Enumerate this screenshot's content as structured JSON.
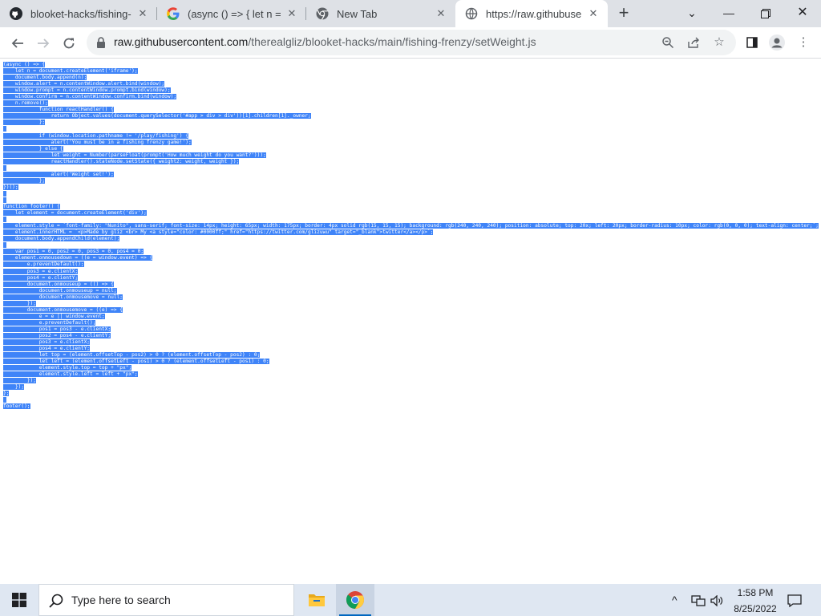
{
  "browser": {
    "tabs": [
      {
        "title": "blooket-hacks/fishing-frenzy",
        "icon": "github-icon"
      },
      {
        "title": "(async () => { let n = doc",
        "icon": "google-icon"
      },
      {
        "title": "New Tab",
        "icon": "chrome-icon"
      },
      {
        "title": "https://raw.githubusercontent.com",
        "icon": "globe-icon"
      }
    ],
    "new_tab_label": "+",
    "url_host": "raw.githubusercontent.com",
    "url_path": "/therealgliz/blooket-hacks/main/fishing-frenzy/setWeight.js"
  },
  "code": {
    "lines": [
      "(async () => {",
      "    let n = document.createElement('iframe');",
      "    document.body.append(n);",
      "    window.alert = n.contentWindow.alert.bind(window);",
      "    window.prompt = n.contentWindow.prompt.bind(window);",
      "    window.confirm = n.contentWindow.confirm.bind(window);",
      "    n.remove();",
      "            function reactHandler() {",
      "                return Object.values(document.querySelector('#app > div > div'))[1].children[1]._owner;",
      "            };",
      "",
      "            if (window.location.pathname != '/play/fishing') {",
      "                alert('You must be in a fishing frenzy game!');",
      "            } else {",
      "                let weight = Number(parseFloat(prompt('How much weight do you want?')));",
      "                reactHandler().stateNode.setState({ weight2: weight, weight });",
      "",
      "                alert('Weight set!');",
      "            };",
      "})();",
      "",
      "",
      "function footer() {",
      "    let element = document.createElement('div');",
      "",
      "    element.style = `font-family: \"Nunito\", sans-serif; font-size: 14px; height: 65px; width: 175px; border: 4px solid rgb(15, 15, 15); background: rgb(240, 240, 240); position: absolute; top: 20x; left: 20px; border-radius: 10px; color: rgb(0, 0, 0); text-align: center;`;",
      "    element.innerHTML = `<p>Made by gliz <br> My <a style=\"color: #0000ff;\" href=\"https://twitter.com/glizuwu\" target=\"_blank\">twitter</a></p>`;",
      "    document.body.appendChild(element);",
      "",
      "    var pos1 = 0, pos2 = 0, pos3 = 0, pos4 = 0;",
      "    element.onmousedown = ((e = window.event) => {",
      "        e.preventDefault();",
      "        pos3 = e.clientX;",
      "        pos4 = e.clientY;",
      "        document.onmouseup = (() => {",
      "            document.onmouseup = null;",
      "            document.onmousemove = null;",
      "        });",
      "        document.onmousemove = ((e) => {",
      "            e = e || window.event;",
      "            e.preventDefault();",
      "            pos1 = pos3 - e.clientX;",
      "            pos2 = pos4 - e.clientY;",
      "            pos3 = e.clientX;",
      "            pos4 = e.clientY;",
      "            let top = (element.offsetTop - pos2) > 0 ? (element.offsetTop - pos2) : 0;",
      "            let left = (element.offsetLeft - pos1) > 0 ? (element.offsetLeft - pos1) : 0;",
      "            element.style.top = top + \"px\";",
      "            element.style.left = left + \"px\";",
      "        });",
      "    });",
      "};",
      "",
      "footer();"
    ]
  },
  "taskbar": {
    "search_placeholder": "Type here to search",
    "time": "1:58 PM",
    "date": "8/25/2022"
  },
  "colors": {
    "selection": "#3f84f8",
    "tabstrip": "#dee1e6",
    "taskbar": "#dfe7f2"
  }
}
